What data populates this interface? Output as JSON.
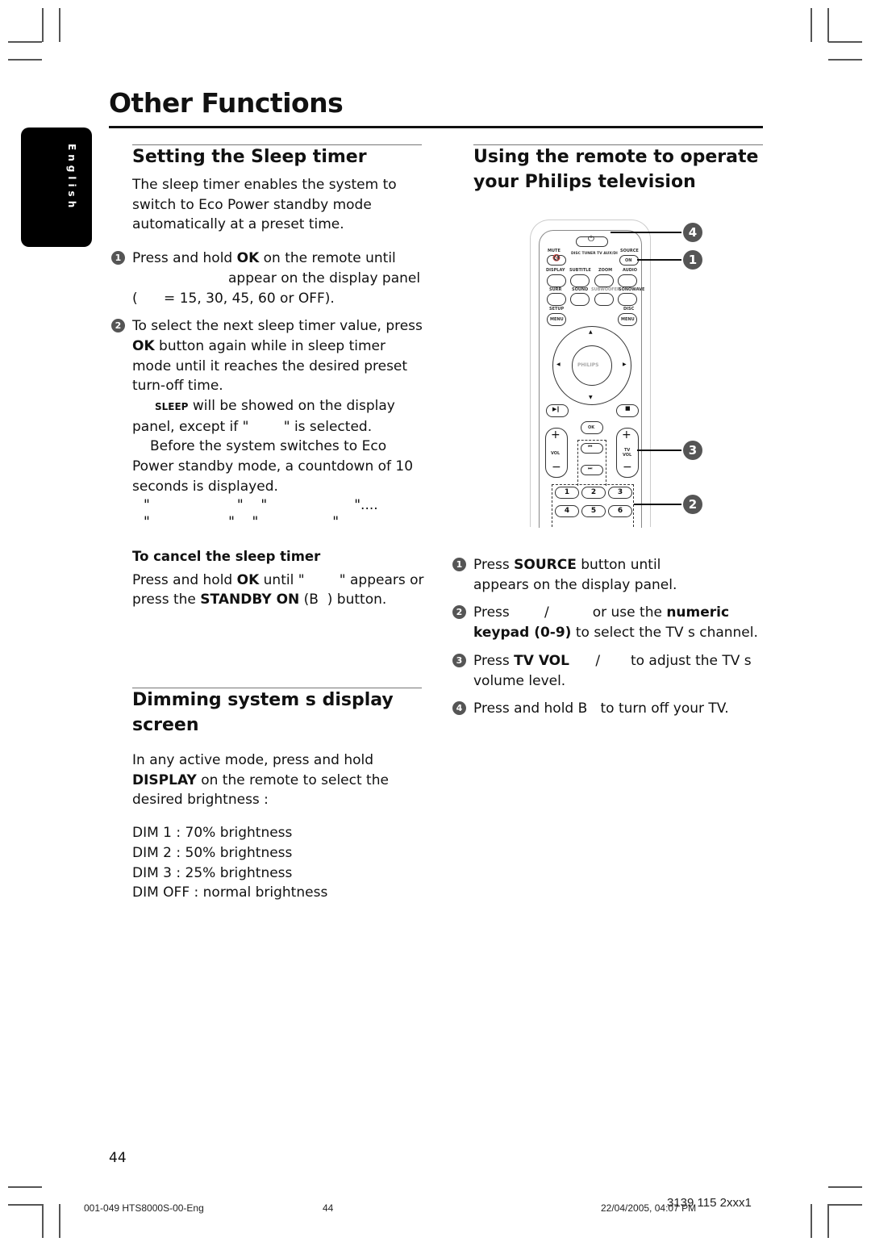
{
  "page": {
    "title": "Other Functions",
    "language_tab": "English",
    "page_number": "44"
  },
  "sleep_timer": {
    "heading": "Setting the Sleep timer",
    "intro": "The sleep timer enables the system to switch to Eco Power standby mode automatically at a preset time.",
    "step1": {
      "num": "1",
      "pre": "Press and hold ",
      "bold": "OK",
      "post": " on the remote until",
      "line2": "appear on the display panel",
      "line3": "(      = 15, 30, 45, 60 or OFF)."
    },
    "step2": {
      "num": "2",
      "line1": "To select the next sleep timer value, press",
      "bold": "OK",
      "rest": " button again while in sleep timer mode until it reaches the desired preset turn-off time.",
      "note1_caps": "SLEEP",
      "note1_rest": " will be showed on the display panel, except if \"        \" is selected.",
      "note2": "Before the system switches to Eco Power standby mode, a countdown of 10 seconds is displayed.",
      "quote_line1": "\"                    \"    \"                    \"....",
      "quote_line2": "\"                  \"    \"                 \""
    },
    "cancel": {
      "heading": "To cancel the sleep timer",
      "pre": "Press and hold ",
      "ok": "OK",
      "mid": " until \"        \" appears or press the ",
      "standby": "STANDBY ON",
      "post": " (B  ) button."
    }
  },
  "dimming": {
    "heading": "Dimming system s display screen",
    "intro_pre": "In any active mode, press and hold ",
    "intro_bold": "DISPLAY",
    "intro_post": " on the remote to select the desired brightness :",
    "levels": [
      "DIM 1 : 70% brightness",
      "DIM 2 : 50% brightness",
      "DIM 3 : 25% brightness",
      "DIM OFF : normal brightness"
    ]
  },
  "remote_tv": {
    "heading": "Using the remote to operate your  Philips  television",
    "callouts": [
      "4",
      "1",
      "3",
      "2"
    ],
    "remote_labels": {
      "mute": "MUTE",
      "indicators": "DISC TUNER TV AUX/DI",
      "source": "SOURCE",
      "on": "ON",
      "display": "DISPLAY",
      "subtitle": "SUBTITLE",
      "zoom": "ZOOM",
      "audio": "AUDIO",
      "surr": "SURR",
      "sound": "SOUND",
      "subwoofer": "SUBWOOFER",
      "sonowave": "SONOWAVE",
      "setup": "SETUP",
      "disc": "DISC",
      "menu": "MENU",
      "brand": "PHILIPS",
      "ok": "OK",
      "vol": "VOL",
      "tv": "TV",
      "plus": "+",
      "minus": "−",
      "keys": [
        "1",
        "2",
        "3",
        "4",
        "5",
        "6"
      ]
    },
    "steps": [
      {
        "num": "1",
        "pre": "Press ",
        "bold": "SOURCE",
        "post": " button until",
        "line2": "appears on the display panel."
      },
      {
        "num": "2",
        "pre": "Press        /          or use the ",
        "bold": "numeric",
        "bold2": "keypad (0-9)",
        "post": " to select the TV s channel."
      },
      {
        "num": "3",
        "pre": "Press ",
        "bold": "TV VOL",
        "post": "      /       to adjust the TV s",
        "line2": "volume level."
      },
      {
        "num": "4",
        "text": "Press and hold B   to turn off your TV."
      }
    ]
  },
  "footer": {
    "left": "001-049 HTS8000S-00-Eng",
    "center": "44",
    "date": "22/04/2005, 04:07 PM",
    "code": "3139 115 2xxx1"
  }
}
